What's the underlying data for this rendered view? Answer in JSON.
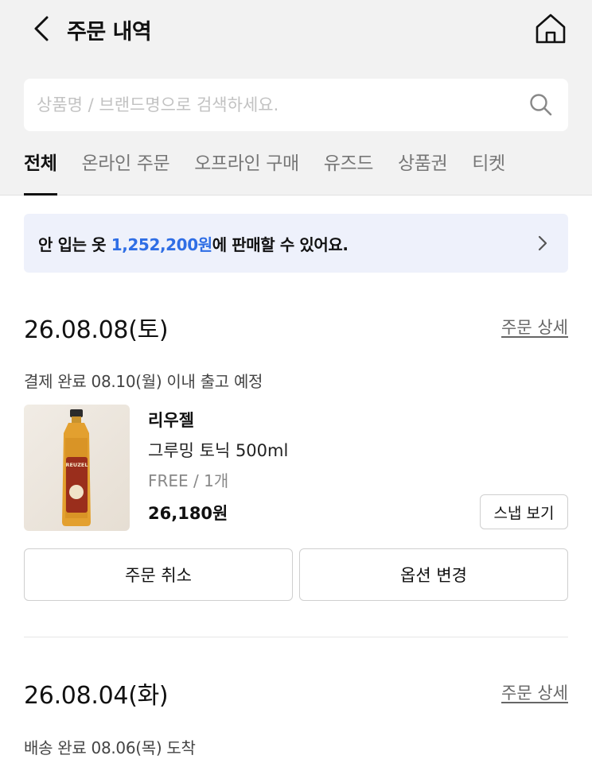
{
  "header": {
    "title": "주문 내역"
  },
  "search": {
    "placeholder": "상품명 / 브랜드명으로 검색하세요."
  },
  "tabs": [
    {
      "label": "전체",
      "active": true
    },
    {
      "label": "온라인 주문"
    },
    {
      "label": "오프라인 구매"
    },
    {
      "label": "유즈드"
    },
    {
      "label": "상품권"
    },
    {
      "label": "티켓"
    }
  ],
  "banner": {
    "prefix": "안 입는 옷 ",
    "amount": "1,252,200원",
    "suffix": "에 판매할 수 있어요."
  },
  "orders": [
    {
      "date": "26.08.08(토)",
      "detail_link": "주문 상세",
      "status": "결제 완료 08.10(월) 이내 출고 예정",
      "item": {
        "brand": "리우젤",
        "name": "그루밍 토닉 500ml",
        "option": "FREE / 1개",
        "price": "26,180원",
        "bottle_label": "REUZEL",
        "snapshot_label": "스냅 보기"
      },
      "buttons": {
        "cancel": "주문 취소",
        "change_option": "옵션 변경"
      }
    },
    {
      "date": "26.08.04(화)",
      "detail_link": "주문 상세",
      "status": "배송 완료 08.06(목) 도착"
    }
  ],
  "colors": {
    "accent": "#2f6ee5",
    "banner_bg": "#eef1fb",
    "top_bg": "#f2f2f2"
  },
  "icons": {
    "back": "chevron-left-icon",
    "home": "home-icon",
    "search": "search-icon",
    "banner": "chevron-right-icon"
  }
}
